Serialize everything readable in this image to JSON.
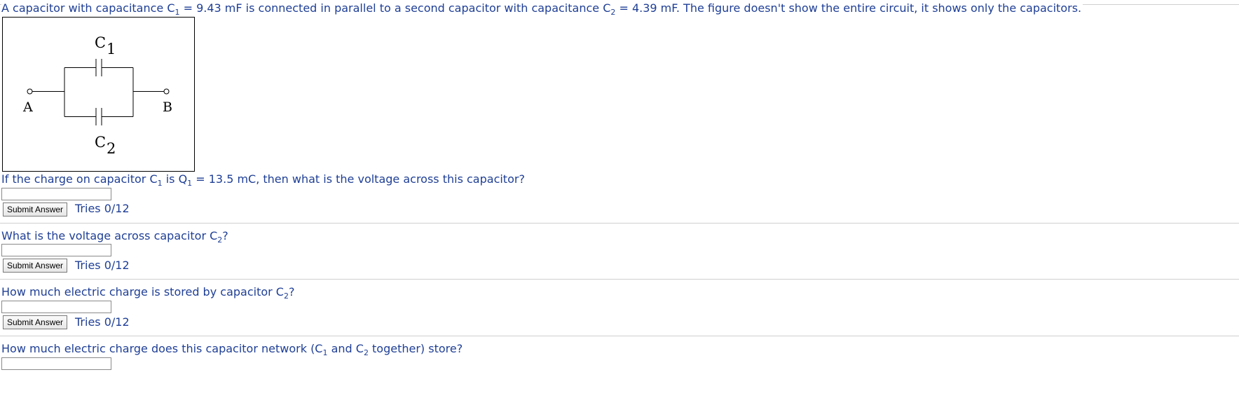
{
  "problem": {
    "intro_a": "A capacitor with capacitance C",
    "intro_sub1": "1",
    "intro_b": " = 9.43 mF is connected in parallel to a second capacitor with capacitance C",
    "intro_sub2": "2",
    "intro_c": " = 4.39 mF. The figure doesn't show the entire circuit, it shows only the capacitors."
  },
  "figure": {
    "c1_letter": "C",
    "c1_sub": "1",
    "c2_letter": "C",
    "c2_sub": "2",
    "node_a": "A",
    "node_b": "B"
  },
  "questions": [
    {
      "text_a": "If the charge on capacitor C",
      "sub1": "1",
      "text_b": " is Q",
      "sub2": "1",
      "text_c": " = 13.5 mC, then what is the voltage across this capacitor?",
      "answer_value": "",
      "submit_label": "Submit Answer",
      "tries": "Tries 0/12"
    },
    {
      "text_a": "What is the voltage across capacitor C",
      "sub1": "2",
      "text_b": "?",
      "answer_value": "",
      "submit_label": "Submit Answer",
      "tries": "Tries 0/12"
    },
    {
      "text_a": "How much electric charge is stored by capacitor C",
      "sub1": "2",
      "text_b": "?",
      "answer_value": "",
      "submit_label": "Submit Answer",
      "tries": "Tries 0/12"
    },
    {
      "text_a": "How much electric charge does this capacitor network (C",
      "sub1": "1",
      "text_b": " and C",
      "sub2": "2",
      "text_c": " together) store?",
      "answer_value": ""
    }
  ]
}
